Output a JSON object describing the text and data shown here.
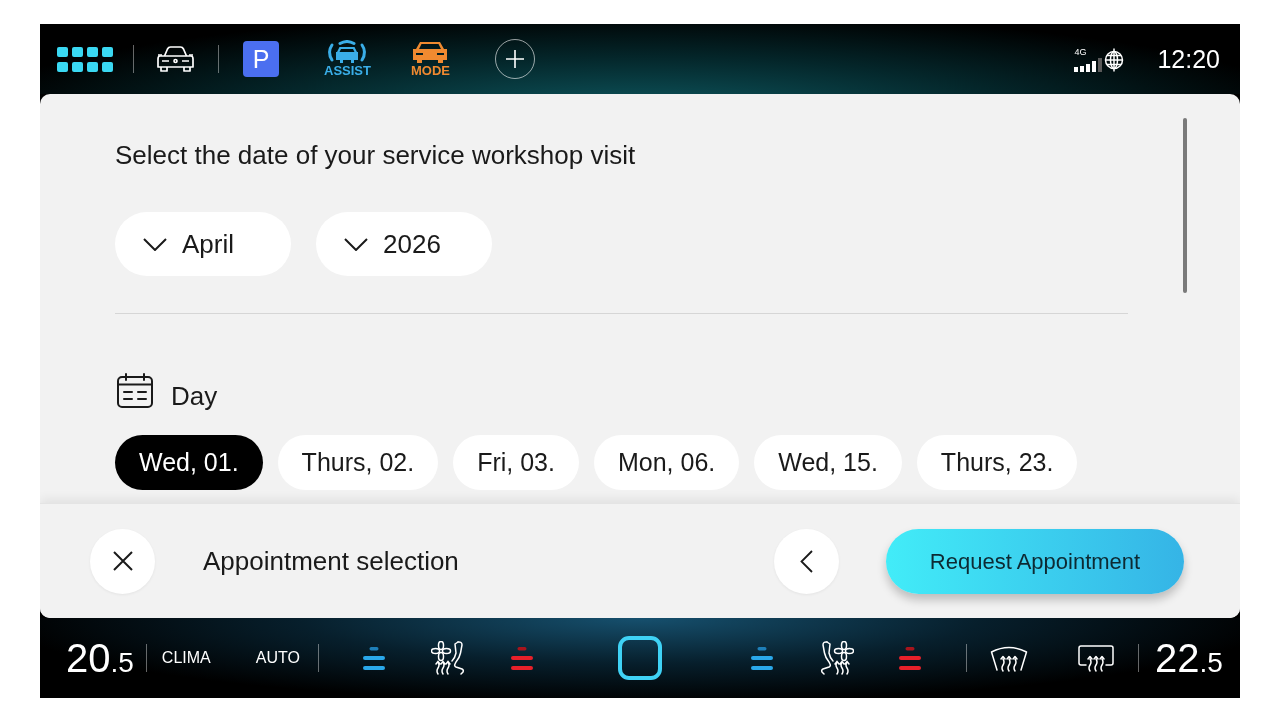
{
  "status_bar": {
    "parking_button": "P",
    "assist_button": "ASSIST",
    "mode_button": "MODE",
    "network_type": "4G",
    "time": "12:20"
  },
  "date_picker": {
    "title": "Select the date of your service workshop visit",
    "dropdowns": [
      {
        "value": "April"
      },
      {
        "value": "2026"
      }
    ],
    "day_section": {
      "label": "Day",
      "days": [
        {
          "label": "Wed, 01.",
          "selected": true
        },
        {
          "label": "Thurs, 02.",
          "selected": false
        },
        {
          "label": "Fri, 03.",
          "selected": false
        },
        {
          "label": "Mon, 06.",
          "selected": false
        },
        {
          "label": "Wed, 15.",
          "selected": false
        },
        {
          "label": "Thurs, 23.",
          "selected": false
        }
      ]
    }
  },
  "bottom_sheet": {
    "title": "Appointment selection",
    "request_button": "Request Appointment"
  },
  "climate_bar": {
    "left_temperature": {
      "whole": "20",
      "fraction": ".5"
    },
    "clima_button": "CLIMA",
    "auto_button": "AUTO",
    "right_temperature": {
      "whole": "22",
      "fraction": ".5"
    }
  }
}
